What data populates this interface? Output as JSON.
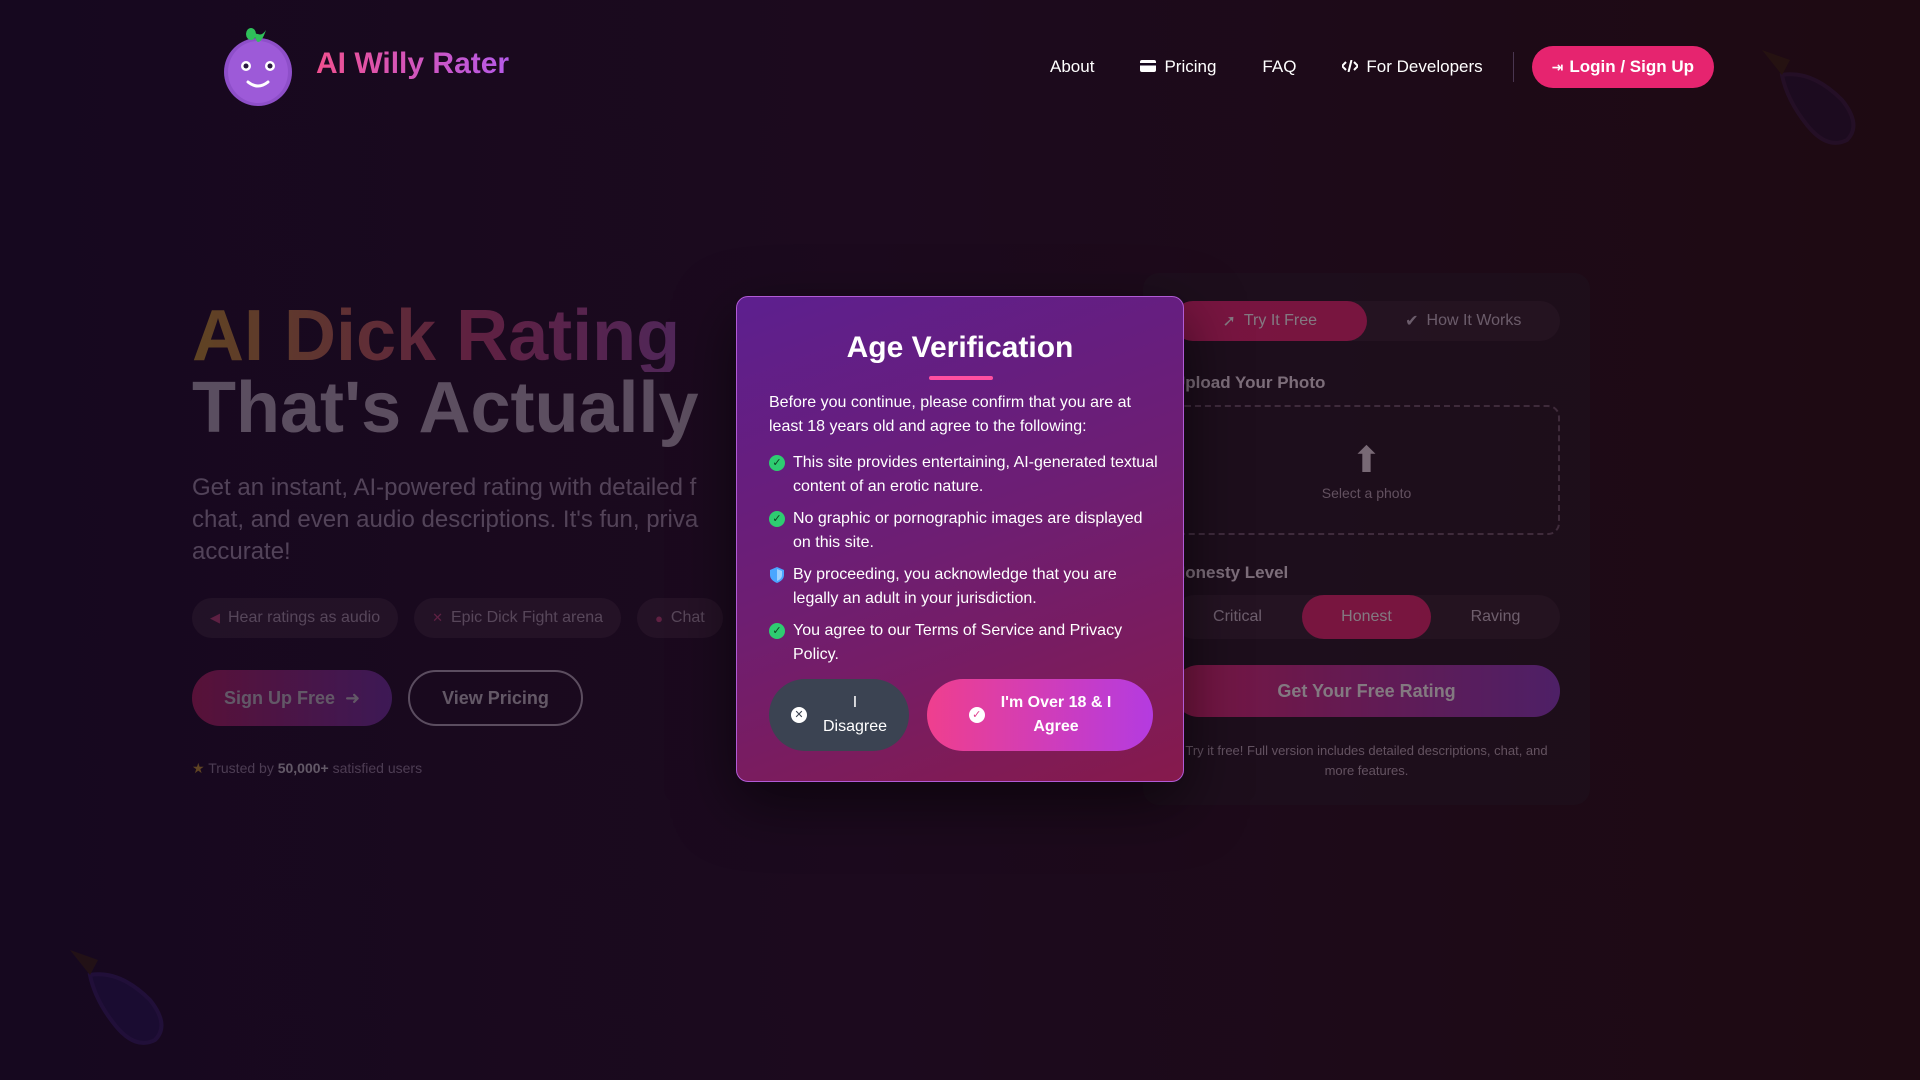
{
  "header": {
    "brand": "AI Willy Rater",
    "nav": [
      {
        "label": "About",
        "icon": ""
      },
      {
        "label": "Pricing",
        "icon": "card-icon"
      },
      {
        "label": "FAQ",
        "icon": ""
      },
      {
        "label": "For Developers",
        "icon": "code-icon"
      }
    ],
    "login_label": "Login / Sign Up"
  },
  "hero": {
    "title_line1": "AI Dick Rating",
    "title_line2": "That's Actually",
    "description": "Get an instant, AI-powered rating with detailed f chat, and even audio descriptions. It's fun, priva accurate!",
    "chips": [
      "Hear ratings as audio",
      "Epic Dick Fight arena",
      "Chat"
    ],
    "signup_label": "Sign Up Free",
    "pricing_label": "View Pricing",
    "trusted_prefix": "Trusted by",
    "trusted_count": "50,000+",
    "trusted_suffix": "satisfied users"
  },
  "card": {
    "tabs": [
      "Try It Free",
      "How It Works"
    ],
    "upload_label": "Upload Your Photo",
    "upload_hint": "Select a photo",
    "honesty_label": "Honesty Level",
    "levels": [
      "Critical",
      "Honest",
      "Raving"
    ],
    "cta": "Get Your Free Rating",
    "note": "Try it free! Full version includes detailed descriptions, chat, and more features."
  },
  "modal": {
    "title": "Age Verification",
    "intro": "Before you continue, please confirm that you are at least 18 years old and agree to the following:",
    "items": [
      {
        "text": "This site provides entertaining, AI-generated textual content of an erotic nature.",
        "icon": "check-circle-icon"
      },
      {
        "text": "No graphic or pornographic images are displayed on this site.",
        "icon": "check-circle-icon"
      },
      {
        "text": "By proceeding, you acknowledge that you are legally an adult in your jurisdiction.",
        "icon": "shield-icon"
      },
      {
        "text": "You agree to our Terms of Service and Privacy Policy.",
        "icon": "check-circle-icon"
      }
    ],
    "disagree_line1": "I",
    "disagree_line2": "Disagree",
    "agree_line1": "I'm Over 18 & I",
    "agree_line2": "Agree"
  },
  "colors": {
    "accent_pink": "#e6246f",
    "accent_purple": "#8a3bc8",
    "check_green": "#2ecc71"
  }
}
